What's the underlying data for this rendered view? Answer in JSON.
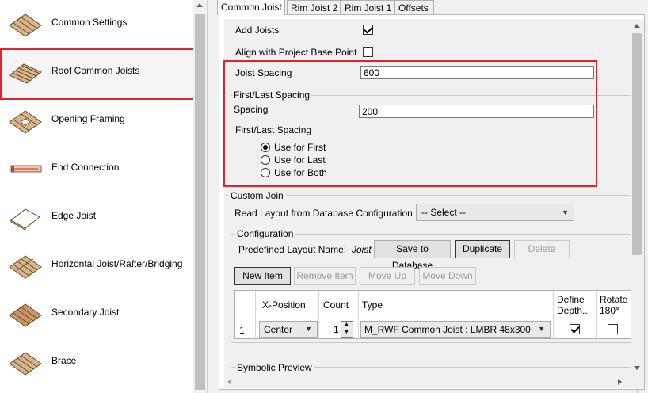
{
  "left_nav": {
    "items": [
      {
        "label": "Common Settings",
        "icon": "joist-grid-icon"
      },
      {
        "label": "Roof Common Joists",
        "icon": "roof-joist-icon"
      },
      {
        "label": "Opening Framing",
        "icon": "opening-framing-icon"
      },
      {
        "label": "End Connection",
        "icon": "end-connection-icon"
      },
      {
        "label": "Edge Joist",
        "icon": "edge-joist-icon"
      },
      {
        "label": "Horizontal Joist/Rafter/Bridging",
        "icon": "horizontal-joist-icon"
      },
      {
        "label": "Secondary Joist",
        "icon": "secondary-joist-icon"
      },
      {
        "label": "Brace",
        "icon": "brace-icon"
      }
    ],
    "selected_index": 1
  },
  "tabs": [
    "Common Joist",
    "Rim Joist 2",
    "Rim Joist 1",
    "Offsets"
  ],
  "active_tab": 0,
  "form": {
    "add_joists_label": "Add Joists",
    "add_joists_checked": true,
    "align_label": "Align with Project Base Point",
    "align_checked": false,
    "joist_spacing_label": "Joist Spacing",
    "joist_spacing_value": "600",
    "first_last_group": "First/Last Spacing",
    "spacing_label": "Spacing",
    "spacing_value": "200",
    "first_last_label": "First/Last Spacing",
    "radio_options": [
      "Use for First",
      "Use for Last",
      "Use for Both"
    ],
    "radio_selected": 0
  },
  "custom_join": {
    "title": "Custom Join",
    "read_layout_label": "Read Layout from Database Configuration:",
    "select_value": "-- Select --",
    "configuration_title": "Configuration",
    "predefined_label": "Predefined Layout Name:",
    "predefined_value": "Joist",
    "save_button": "Save to Database",
    "duplicate_button": "Duplicate",
    "delete_button": "Delete",
    "new_item_button": "New Item",
    "remove_item_button": "Remove Item",
    "move_up_button": "Move Up",
    "move_down_button": "Move Down"
  },
  "grid": {
    "headers": [
      "X-Position",
      "Count",
      "Type",
      "Define Depth...",
      "Rotate 180°"
    ],
    "rows": [
      {
        "row_num": "1",
        "x_position": "Center",
        "count": "1",
        "type": "M_RWF Common Joist : LMBR 48x300",
        "define_depth": true,
        "rotate": false
      }
    ]
  },
  "symbolic_preview_title": "Symbolic Preview",
  "colors": {
    "highlight": "#e0242a",
    "accent_blue": "#0078d7"
  }
}
